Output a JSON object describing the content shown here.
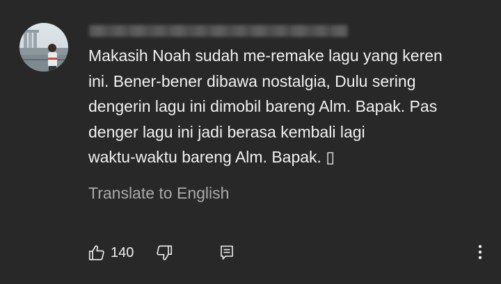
{
  "comment": {
    "author_redacted": true,
    "text_lines": [
      "Makasih Noah sudah me-remake lagu yang keren",
      "ini. Bener-bener dibawa nostalgia, Dulu sering",
      "dengerin lagu ini dimobil bareng Alm. Bapak. Pas",
      "denger lagu ini jadi berasa kembali lagi",
      "waktu-waktu bareng Alm. Bapak. ▯"
    ],
    "translate_label": "Translate to English"
  },
  "actions": {
    "like_count": "140",
    "like_icon": "thumb-up-icon",
    "dislike_icon": "thumb-down-icon",
    "reply_icon": "reply-comment-icon",
    "more_icon": "more-vert-icon"
  },
  "colors": {
    "background": "#282828",
    "text": "#f1f1f1",
    "secondary_text": "#aaaaaa"
  }
}
